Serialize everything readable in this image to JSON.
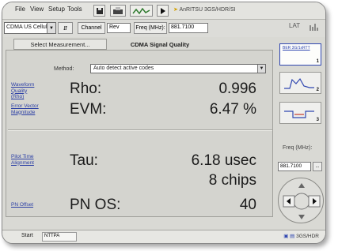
{
  "menubar": {
    "items": [
      "File",
      "View",
      "Setup",
      "Tools"
    ],
    "toolbar_status": "AnRITSU 3GS/HDR/SI"
  },
  "toolbar2": {
    "standard_combo": "CDMA US Cellular",
    "channel_label": "Channel",
    "channel_value": "Rev",
    "freq_label": "Freq (MHz):",
    "freq_value": "881.7100",
    "right_indicator": "LAT"
  },
  "tabs": {
    "select_measurement": "Select Measurement...",
    "active_title": "CDMA Signal Quality"
  },
  "panel": {
    "method_label": "Method:",
    "method_value": "Auto detect active codes",
    "links": {
      "waveform_quality": "Waveform Quality (Rho)",
      "error_vector": "Error Vector Magnitude",
      "time_alignment": "Pilot Time Alignment",
      "pn_offset": "PN Offset"
    },
    "rows": {
      "rho_label": "Rho:",
      "rho_value": "0.996",
      "evm_label": "EVM:",
      "evm_value": "6.47 %",
      "tau_label": "Tau:",
      "tau_value": "6.18 usec",
      "tau_chips": "8 chips",
      "pnos_label": "PN OS:",
      "pnos_value": "40"
    }
  },
  "sidebar": {
    "button1_label": "BER 3G/1xRTT",
    "button1_num": "1",
    "button2_num": "2",
    "button3_num": "3",
    "freq_label": "Freq (MHz):",
    "freq_value": "881.7100",
    "freq_more": "..."
  },
  "taskbar": {
    "start_label": "Start",
    "task_label": "NTTPA",
    "tray_text": "3GS/HDR"
  },
  "colors": {
    "accent": "#2f46b0",
    "link": "#2a3ea5",
    "panel_bg": "#d4d4cf"
  }
}
